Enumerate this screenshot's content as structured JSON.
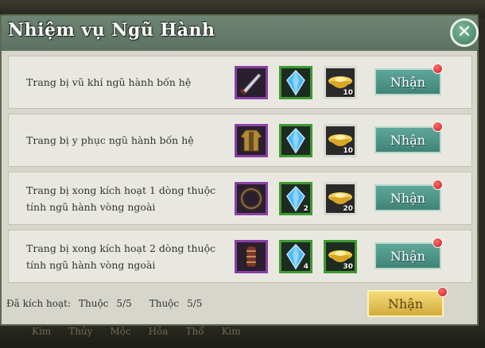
{
  "title": "Nhiệm vụ Ngũ Hành",
  "close_label": "✕",
  "claim_label": "Nhận",
  "tasks": [
    {
      "desc": "Trang bị vũ khí ngũ hành bốn hệ",
      "rewards": [
        {
          "icon": "weapon-icon",
          "quality": "purple",
          "qty": ""
        },
        {
          "icon": "crystal-icon",
          "quality": "green",
          "qty": ""
        },
        {
          "icon": "gold-ingot-icon",
          "quality": "white",
          "qty": "10"
        }
      ]
    },
    {
      "desc": "Trang bị y phục ngũ hành bốn hệ",
      "rewards": [
        {
          "icon": "armor-icon",
          "quality": "purple",
          "qty": ""
        },
        {
          "icon": "crystal-icon",
          "quality": "green",
          "qty": ""
        },
        {
          "icon": "gold-ingot-icon",
          "quality": "white",
          "qty": "10"
        }
      ]
    },
    {
      "desc": "Trang bị xong kích hoạt 1 dòng thuộc tính ngũ hành vòng ngoài",
      "rewards": [
        {
          "icon": "ring-icon",
          "quality": "purple",
          "qty": ""
        },
        {
          "icon": "crystal-icon",
          "quality": "green",
          "qty": "2"
        },
        {
          "icon": "gold-ingot-icon",
          "quality": "white",
          "qty": "20"
        }
      ]
    },
    {
      "desc": "Trang bị xong kích hoạt 2 dòng thuộc tính ngũ hành vòng ngoài",
      "rewards": [
        {
          "icon": "bracer-icon",
          "quality": "purple",
          "qty": ""
        },
        {
          "icon": "crystal-icon",
          "quality": "green",
          "qty": "4"
        },
        {
          "icon": "gold-ingot-icon",
          "quality": "green",
          "qty": "30"
        }
      ]
    }
  ],
  "status": {
    "label": "Đã kích hoạt:",
    "attr1_name": "Thuộc",
    "attr1_value": "5/5",
    "attr2_name": "Thuộc",
    "attr2_value": "5/5"
  },
  "claim_all_label": "Nhận",
  "background_tabs": [
    "Kim",
    "Thủy",
    "Mộc",
    "Hỏa",
    "Thổ",
    "Kim"
  ],
  "colors": {
    "claim_button": "#4f9588",
    "claim_all_button": "#e6c45a",
    "notification_dot": "#d62a2a",
    "quality_purple": "#8a3fa6",
    "quality_green": "#3c9a2f",
    "quality_white": "#d9d9d2"
  }
}
